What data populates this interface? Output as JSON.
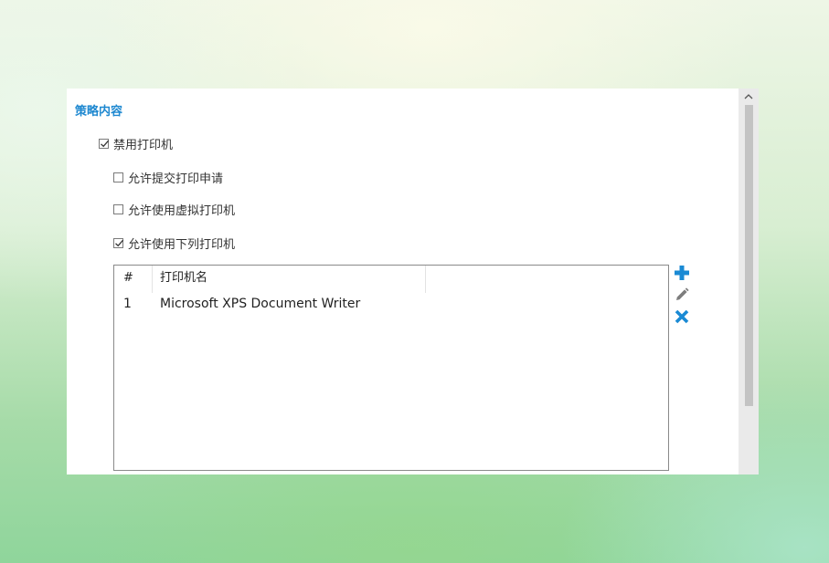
{
  "section": {
    "title": "策略内容"
  },
  "options": {
    "disable_printer": {
      "label": "禁用打印机",
      "checked": true
    },
    "allow_submit_request": {
      "label": "允许提交打印申请",
      "checked": false
    },
    "allow_virtual_printer": {
      "label": "允许使用虚拟打印机",
      "checked": false
    },
    "allow_listed_printers": {
      "label": "允许使用下列打印机",
      "checked": true
    }
  },
  "printer_list": {
    "columns": [
      "#",
      "打印机名"
    ],
    "rows": [
      {
        "index": "1",
        "name": "Microsoft XPS Document Writer"
      }
    ]
  },
  "actions": {
    "add_icon": "plus-icon",
    "edit_icon": "pencil-icon",
    "delete_icon": "close-icon"
  },
  "colors": {
    "accent": "#1e88d0",
    "icon_blue": "#1a8ad4",
    "icon_gray": "#7d7d7d"
  }
}
